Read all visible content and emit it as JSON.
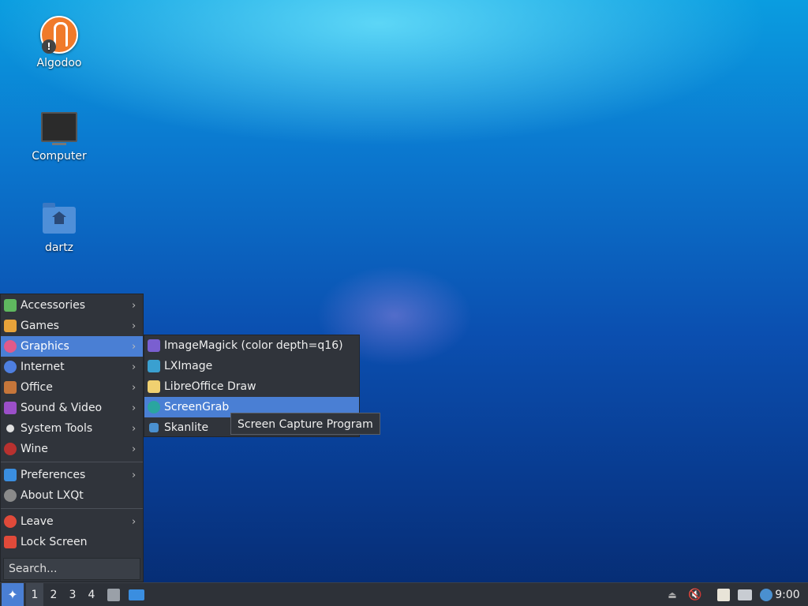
{
  "desktop": {
    "icons": [
      {
        "label": "Algodoo",
        "icon": "algodoo-icon"
      },
      {
        "label": "Computer",
        "icon": "computer-icon"
      },
      {
        "label": "dartz",
        "icon": "home-folder-icon"
      }
    ]
  },
  "menu": {
    "items": [
      {
        "label": "Accessories",
        "icon": "accessories-icon",
        "color": "#5fb85f",
        "submenu": true
      },
      {
        "label": "Games",
        "icon": "games-icon",
        "color": "#e8a33a",
        "submenu": true
      },
      {
        "label": "Graphics",
        "icon": "graphics-icon",
        "color": "#e05a8a",
        "submenu": true
      },
      {
        "label": "Internet",
        "icon": "internet-icon",
        "color": "#4e7fe0",
        "submenu": true
      },
      {
        "label": "Office",
        "icon": "office-icon",
        "color": "#c6763a",
        "submenu": true
      },
      {
        "label": "Sound & Video",
        "icon": "sound-video-icon",
        "color": "#9b4fc9",
        "submenu": true
      },
      {
        "label": "System Tools",
        "icon": "system-tools-icon",
        "color": "#e0e0e0",
        "submenu": true
      },
      {
        "label": "Wine",
        "icon": "wine-icon",
        "color": "#b8312f",
        "submenu": true
      }
    ],
    "items2": [
      {
        "label": "Preferences",
        "icon": "preferences-icon",
        "color": "#3a8ee0",
        "submenu": true
      },
      {
        "label": "About LXQt",
        "icon": "about-icon",
        "color": "#8a8a8a",
        "submenu": false
      }
    ],
    "items3": [
      {
        "label": "Leave",
        "icon": "power-icon",
        "color": "#e04a3a",
        "submenu": true
      },
      {
        "label": "Lock Screen",
        "icon": "lock-icon",
        "color": "#e04a3a",
        "submenu": false
      }
    ],
    "search_placeholder": "Search...",
    "active": "Graphics",
    "accent": "#4a7fd4"
  },
  "submenu": {
    "items": [
      {
        "label": "ImageMagick (color depth=q16)",
        "icon": "imagemagick-icon",
        "color": "#7a5fd0"
      },
      {
        "label": "LXImage",
        "icon": "lximage-icon",
        "color": "#3aa0d0"
      },
      {
        "label": "LibreOffice Draw",
        "icon": "libreoffice-draw-icon",
        "color": "#f0d070"
      },
      {
        "label": "ScreenGrab",
        "icon": "screengrab-icon",
        "color": "#2aa5a0"
      },
      {
        "label": "Skanlite",
        "icon": "skanlite-icon",
        "color": "#4a90d0"
      }
    ],
    "active": "ScreenGrab"
  },
  "tooltip": "Screen Capture Program",
  "taskbar": {
    "desktops": [
      "1",
      "2",
      "3",
      "4"
    ],
    "current_desktop": "1",
    "clock": "9:00"
  }
}
